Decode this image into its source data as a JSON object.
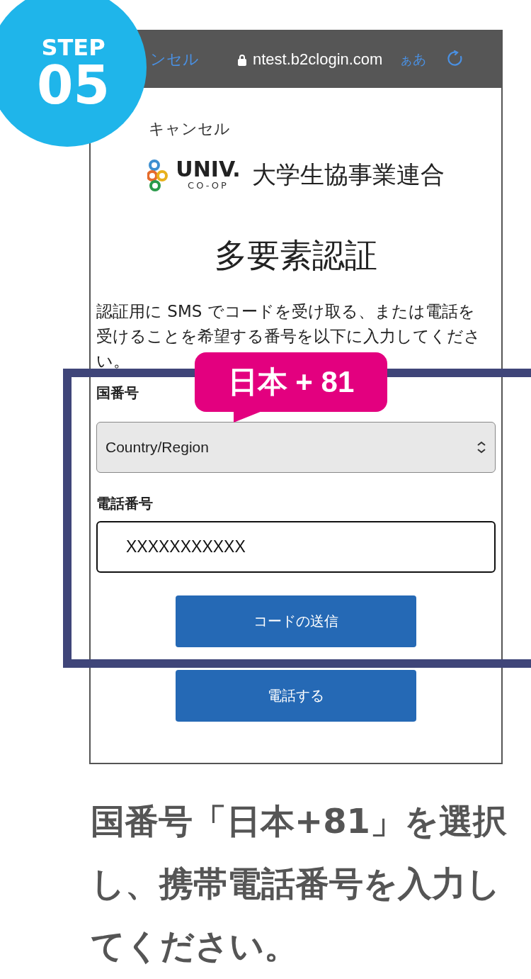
{
  "step": {
    "label": "STEP",
    "number": "05"
  },
  "browser_bar": {
    "cancel": "ンセル",
    "url": "ntest.b2clogin.com",
    "text_size": "ぁあ"
  },
  "page": {
    "cancel_link": "キャンセル",
    "logo": {
      "wordmark": "UNIV.",
      "subline": "CO-OP",
      "org_name": "大学生協事業連合"
    },
    "title": "多要素認証",
    "description": "認証用に SMS でコードを受け取る、または電話を受けることを希望する番号を以下に入力してください。",
    "fields": [
      {
        "kind": "select",
        "label": "国番号",
        "value": "Country/Region"
      },
      {
        "kind": "text",
        "label": "電話番号",
        "value": "XXXXXXXXXXX"
      }
    ],
    "buttons": [
      "コードの送信",
      "電話する"
    ]
  },
  "callout": "日本 + 81",
  "caption": "国番号「日本+81」を選択し、携帯電話番号を入力してください。"
}
